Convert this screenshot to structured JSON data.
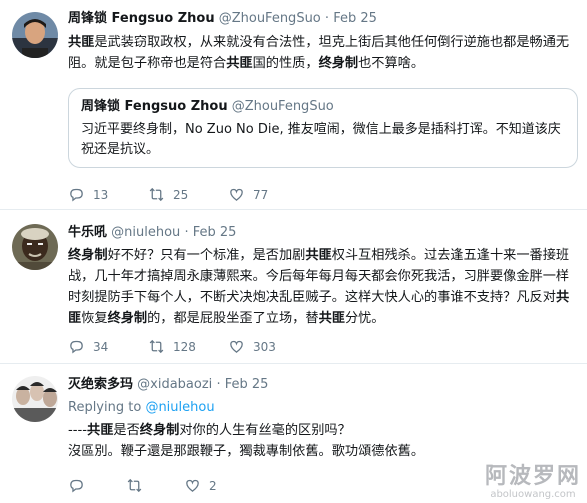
{
  "tweets": [
    {
      "name": "周锋锁 Fengsuo Zhou",
      "handle": "@ZhouFengSuo",
      "sep": "·",
      "date": "Feb 25",
      "text": [
        {
          "t": "共匪",
          "b": true
        },
        {
          "t": "是武装窃取政权，从来就没有合法性，坦克上街后其他任何倒行逆施也都是畅通无阻。就是包子称帝也是符合",
          "b": false
        },
        {
          "t": "共匪",
          "b": true
        },
        {
          "t": "国的性质，",
          "b": false
        },
        {
          "t": "终身制",
          "b": true
        },
        {
          "t": "也不算啥。",
          "b": false
        }
      ],
      "quote": {
        "name": "周锋锁 Fengsuo Zhou",
        "handle": "@ZhouFengSuo",
        "text": "习近平要终身制，No Zuo No Die, 推友喧闹，微信上最多是插科打诨。不知道该庆祝还是抗议。"
      },
      "actions": {
        "replies": "13",
        "retweets": "25",
        "likes": "77"
      }
    },
    {
      "name": "牛乐吼",
      "handle": "@niulehou",
      "sep": "·",
      "date": "Feb 25",
      "text": [
        {
          "t": "终身制",
          "b": true
        },
        {
          "t": "好不好？只有一个标准，是否加剧",
          "b": false
        },
        {
          "t": "共匪",
          "b": true
        },
        {
          "t": "权斗互相残杀。过去逢五逢十来一番接班战，几十年才搞掉周永康薄熙来。今后每年每月每天都会你死我活，习胖要像金胖一样时刻提防手下每个人，不断犬决炮决乱臣贼子。这样大快人心的事谁不支持？凡反对",
          "b": false
        },
        {
          "t": "共匪",
          "b": true
        },
        {
          "t": "恢复",
          "b": false
        },
        {
          "t": "终身制",
          "b": true
        },
        {
          "t": "的，都是屁股坐歪了立场，替",
          "b": false
        },
        {
          "t": "共匪",
          "b": true
        },
        {
          "t": "分忧。",
          "b": false
        }
      ],
      "actions": {
        "replies": "34",
        "retweets": "128",
        "likes": "303"
      }
    },
    {
      "name": "灭绝索多玛",
      "handle": "@xidabaozi",
      "sep": "·",
      "date": "Feb 25",
      "replying_prefix": "Replying to",
      "replying_to": "@niulehou",
      "text": [
        {
          "t": "----",
          "b": false
        },
        {
          "t": "共匪",
          "b": true
        },
        {
          "t": "是否",
          "b": false
        },
        {
          "t": "终身制",
          "b": true
        },
        {
          "t": "对你的人生有丝毫的区别吗？",
          "b": false
        },
        {
          "t": "\n沒區別。鞭子還是那跟鞭子，獨裁專制依舊。歌功頌德依舊。",
          "b": false
        }
      ],
      "actions": {
        "replies": "",
        "retweets": "",
        "likes": "2"
      }
    }
  ],
  "watermark": {
    "cn": "阿波罗网",
    "en": "aboluowang.com"
  },
  "colors": {
    "blue": "#1da1f2",
    "gray": "#657786",
    "border": "#e6ecf0"
  }
}
